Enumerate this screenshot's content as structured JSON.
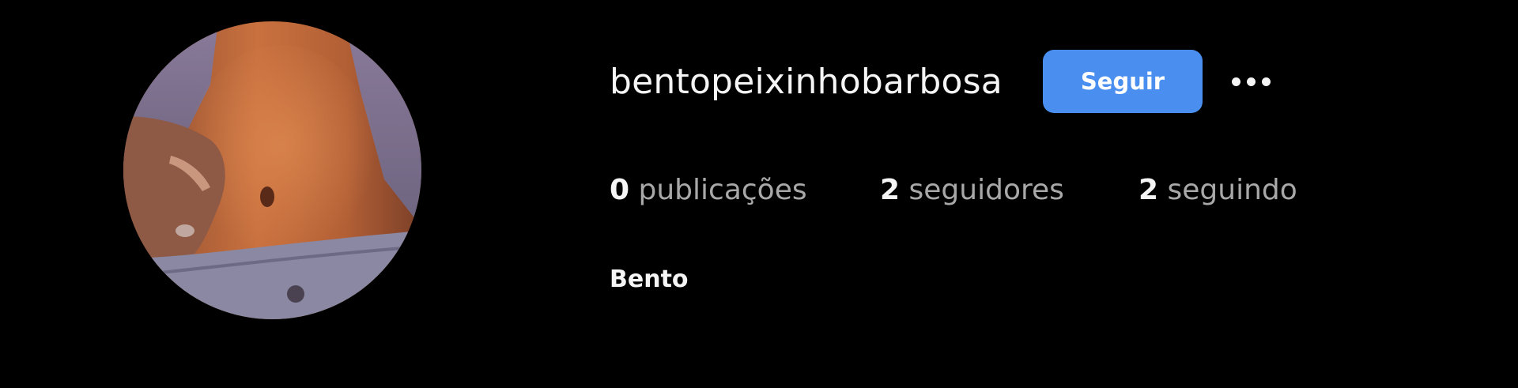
{
  "profile": {
    "username": "bentopeixinhobarbosa",
    "full_name": "Bento",
    "avatar_icon": "profile-photo",
    "follow_label": "Seguir",
    "more_icon": "more-horizontal-icon"
  },
  "stats": {
    "posts_count": "0",
    "posts_label": "publicações",
    "followers_count": "2",
    "followers_label": "seguidores",
    "following_count": "2",
    "following_label": "seguindo"
  },
  "colors": {
    "background": "#000000",
    "accent": "#4a8ff0",
    "text_primary": "#f5f5f5",
    "text_secondary": "#a8a8a8"
  }
}
